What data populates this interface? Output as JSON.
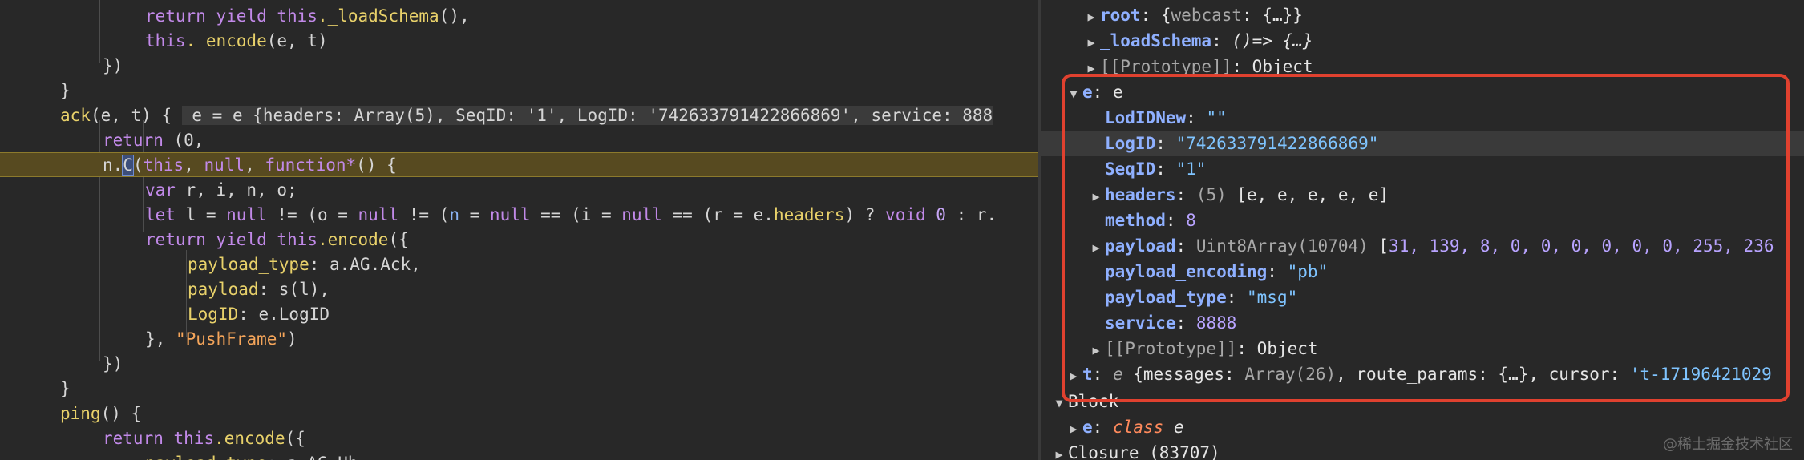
{
  "code": {
    "l1": {
      "ret": "return ",
      "yield": "yield ",
      "this": "this",
      "call": "._loadSchema",
      "rest": "(),"
    },
    "l2": {
      "this": "this",
      "call": "._encode",
      "rest": "(e, t)"
    },
    "l3": "})",
    "l4": "}",
    "l5": {
      "name": "ack",
      "params": "(e, t) {",
      "inline": " e = e {headers: Array(5), SeqID: '1', LogID: '742633791422866869', service: 888"
    },
    "l6": {
      "ret": "return ",
      "rest": "(0,"
    },
    "l7": {
      "obj": "n.",
      "cur": "C",
      "open": "(",
      "this": "this",
      "comma": ", ",
      "null": "null",
      "comma2": ", ",
      "fn": "function",
      "star": "*",
      "rest": "() {"
    },
    "l8": {
      "var": "var ",
      "rest": "r, i, n, o;"
    },
    "l9": {
      "let": "let ",
      "a": "l = ",
      "n1": "null",
      "b": " != (o = ",
      "n2": "null",
      "c": " != (",
      "nv": "n",
      "d": " = ",
      "n3": "null",
      "e": " == (i = ",
      "n4": "null",
      "f": " == (r = e.",
      "h": "headers",
      "g": ") ? ",
      "void": "void ",
      "z": "0",
      "t": " : r."
    },
    "l10": {
      "ret": "return ",
      "yield": "yield ",
      "this": "this",
      "call": ".encode",
      "rest": "({"
    },
    "l11": {
      "key": "payload_type",
      "rest": ": a.AG.Ack,"
    },
    "l12": {
      "key": "payload",
      "rest": ": s(l),"
    },
    "l13": {
      "key": "LogID",
      "rest": ": e.LogID"
    },
    "l14": {
      "a": "}, ",
      "str": "\"PushFrame\"",
      "b": ")"
    },
    "l15": "})",
    "l16": "}",
    "l17": {
      "name": "ping",
      "rest": "() {"
    },
    "l18": {
      "ret": "return ",
      "this": "this",
      "call": ".encode",
      "rest": "({"
    },
    "l19": {
      "key": "payload_type",
      "rest": ": a.AG.Hb,"
    }
  },
  "scope": {
    "root": {
      "key": "root",
      "sep": ": ",
      "val_a": "{",
      "val_b": "webcast",
      "val_c": ": {…}}"
    },
    "loadSchema": {
      "key": "_loadSchema",
      "sep": ": ",
      "val": "()=> {…}"
    },
    "proto1": {
      "key": "[[Prototype]]",
      "sep": ": ",
      "val": "Object"
    },
    "e": {
      "key": "e",
      "sep": ": ",
      "val": "e"
    },
    "LodIDNew": {
      "key": "LodIDNew",
      "sep": ": ",
      "val": "\"\""
    },
    "LogID": {
      "key": "LogID",
      "sep": ": ",
      "val": "\"742633791422866869\""
    },
    "SeqID": {
      "key": "SeqID",
      "sep": ": ",
      "val": "\"1\""
    },
    "headers": {
      "key": "headers",
      "sep": ": ",
      "count": "(5) ",
      "val": "[e, e, e, e, e]"
    },
    "method": {
      "key": "method",
      "sep": ": ",
      "val": "8"
    },
    "payload": {
      "key": "payload",
      "sep": ": ",
      "type": "Uint8Array(10704) ",
      "open": "[",
      "nums": "31, 139, 8, 0, 0, 0, 0, 0, 0, 255, 236"
    },
    "payload_encoding": {
      "key": "payload_encoding",
      "sep": ": ",
      "val": "\"pb\""
    },
    "payload_type": {
      "key": "payload_type",
      "sep": ": ",
      "val": "\"msg\""
    },
    "service": {
      "key": "service",
      "sep": ": ",
      "val": "8888"
    },
    "proto2": {
      "key": "[[Prototype]]",
      "sep": ": ",
      "val": "Object"
    },
    "t": {
      "key": "t",
      "sep": ": ",
      "a": "e ",
      "b": "{messages: ",
      "c": "Array(26)",
      "d": ", route_params: ",
      "e": "{…}",
      "f": ", cursor: ",
      "g": "'t-17196421029"
    },
    "block": {
      "label": "Block"
    },
    "eclass": {
      "key": "e",
      "sep": ": ",
      "cls": "class ",
      "val": "e"
    },
    "closure": {
      "label": "Closure (83707)"
    }
  },
  "watermark": "@稀土掘金技术社区",
  "colors": {
    "highlight_box": "#e0412f",
    "exec_line": "#574a20"
  }
}
